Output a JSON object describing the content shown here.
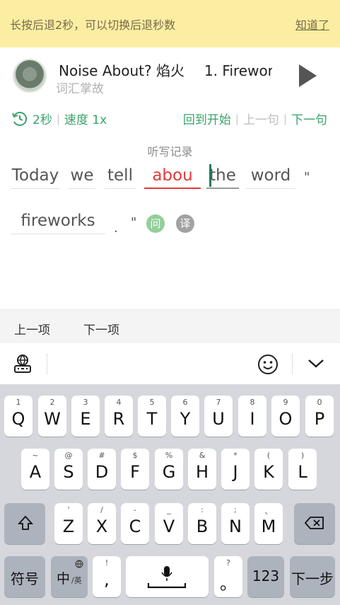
{
  "tip": {
    "text": "长按后退2秒，可以切换后退秒数",
    "dismiss": "知道了"
  },
  "player": {
    "title": "Noise About? 焰火",
    "episode": "1. Firewor",
    "subtitle": "词汇掌故"
  },
  "controls": {
    "rewind": "2秒",
    "speed": "速度 1x",
    "restart": "回到开始",
    "prev_sentence": "上一句",
    "next_sentence": "下一句"
  },
  "record_label": "听写记录",
  "words": [
    "Today",
    "we",
    "tell",
    "abou",
    "the",
    "word",
    "fireworks"
  ],
  "punct": {
    "quote": "\"",
    "period": "."
  },
  "badges": {
    "ask": "问",
    "translate": "译"
  },
  "nav": {
    "prev_item": "上一项",
    "next_item": "下一项"
  },
  "keyboard": {
    "row1": [
      [
        "1",
        "Q"
      ],
      [
        "2",
        "W"
      ],
      [
        "3",
        "E"
      ],
      [
        "4",
        "R"
      ],
      [
        "5",
        "T"
      ],
      [
        "6",
        "Y"
      ],
      [
        "7",
        "U"
      ],
      [
        "8",
        "I"
      ],
      [
        "9",
        "O"
      ],
      [
        "0",
        "P"
      ]
    ],
    "row2": [
      [
        "~",
        "A"
      ],
      [
        "@",
        "S"
      ],
      [
        "#",
        "D"
      ],
      [
        "$",
        "F"
      ],
      [
        "%",
        "G"
      ],
      [
        "&",
        "H"
      ],
      [
        "*",
        "J"
      ],
      [
        "(",
        "K"
      ],
      [
        ")",
        "L"
      ]
    ],
    "row3": [
      [
        "'",
        "Z"
      ],
      [
        "/",
        "X"
      ],
      [
        "-",
        "C"
      ],
      [
        "_",
        "V"
      ],
      [
        ":",
        "B"
      ],
      [
        ";",
        "N"
      ],
      [
        "、",
        "M"
      ]
    ],
    "symbols": "符号",
    "lang": "中",
    "lang_sub": "/英",
    "comma_hint": "!",
    "comma": ",",
    "period_hint": "?",
    "period": "。",
    "num": "123",
    "next": "下一步"
  },
  "colors": {
    "accent": "#3aa36b",
    "error": "#e23a3a",
    "banner": "#fbeea3"
  }
}
